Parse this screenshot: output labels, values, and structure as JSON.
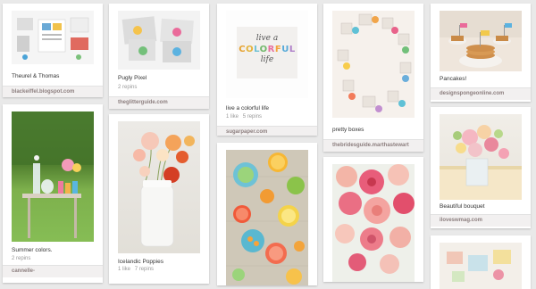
{
  "pins": [
    {
      "description": "Theurel & Thomas",
      "repins": "",
      "likes": "",
      "source": "blackeiffel.blogspot.com"
    },
    {
      "description": "Pugly Pixel",
      "repins": "2 repins",
      "likes": "",
      "source": "theglitterguide.com"
    },
    {
      "description": "live a colorful life",
      "repins": "5 repins",
      "likes": "1 like",
      "source": "sugarpaper.com"
    },
    {
      "description": "pretty boxes",
      "repins": "",
      "likes": "",
      "source": "thebridesguide.marthastewart"
    },
    {
      "description": "Pancakes!",
      "repins": "",
      "likes": "",
      "source": "designspongeonline.com"
    },
    {
      "description": "Summer colors.",
      "repins": "2 repins",
      "likes": "",
      "source": "cannelle-"
    },
    {
      "description": "Icelandic Poppies",
      "repins": "7 repins",
      "likes": "1 like",
      "source": ""
    },
    {
      "description": "",
      "repins": "",
      "likes": "",
      "source": ""
    },
    {
      "description": "",
      "repins": "",
      "likes": "",
      "source": ""
    },
    {
      "description": "Beautiful bouquet",
      "repins": "",
      "likes": "",
      "source": "iloveswmag.com"
    },
    {
      "description": "",
      "repins": "",
      "likes": "",
      "source": ""
    }
  ],
  "artwork": {
    "colorful_life_lines": [
      "live a",
      "COLORFUL",
      "life"
    ],
    "colorful_life_letter_colors": [
      "#e6a12e",
      "#e3b23a",
      "#6cc0d2",
      "#72b86c",
      "#e86f9e",
      "#f2a33b",
      "#55a9d8",
      "#ae7fc9"
    ]
  }
}
